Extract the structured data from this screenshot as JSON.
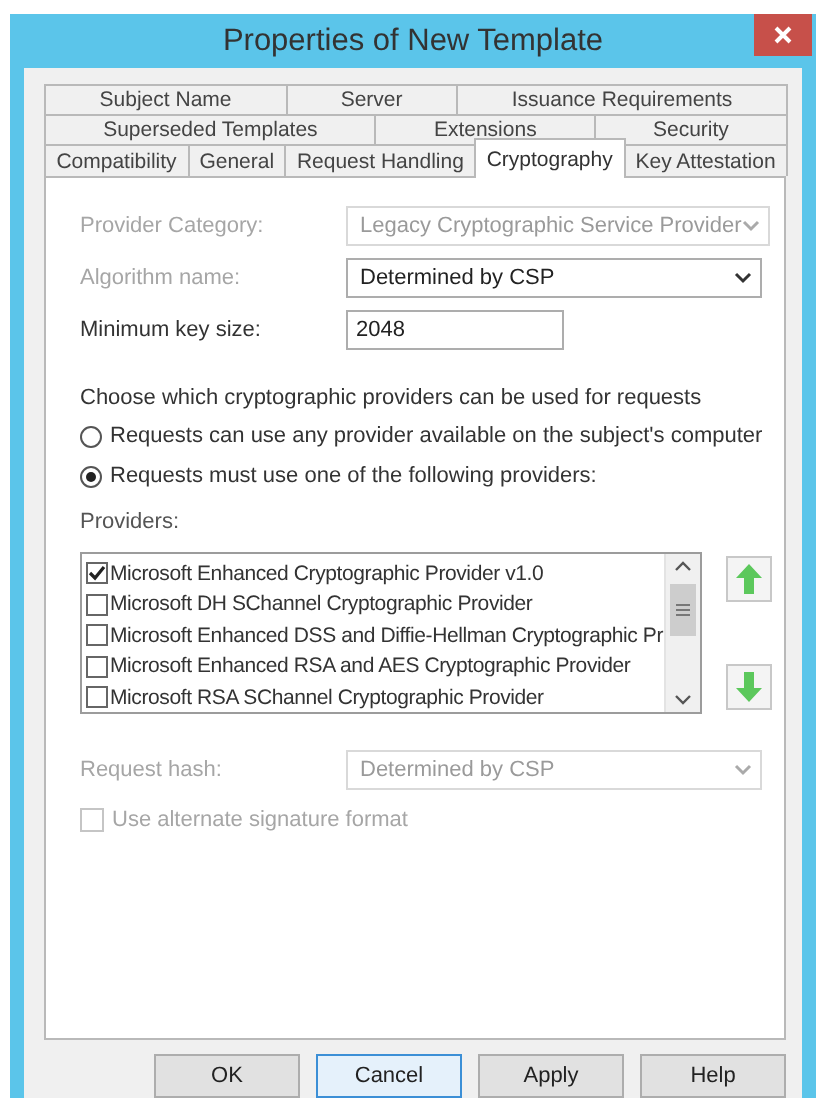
{
  "window": {
    "title": "Properties of New Template"
  },
  "tab_rows": [
    {
      "tabs": [
        {
          "label": "Subject Name",
          "selected": false
        },
        {
          "label": "Server",
          "selected": false
        },
        {
          "label": "Issuance Requirements",
          "selected": false
        }
      ]
    },
    {
      "tabs": [
        {
          "label": "Superseded Templates",
          "selected": false
        },
        {
          "label": "Extensions",
          "selected": false
        },
        {
          "label": "Security",
          "selected": false
        }
      ]
    },
    {
      "tabs": [
        {
          "label": "Compatibility",
          "selected": false
        },
        {
          "label": "General",
          "selected": false
        },
        {
          "label": "Request Handling",
          "selected": false
        },
        {
          "label": "Cryptography",
          "selected": true
        },
        {
          "label": "Key Attestation",
          "selected": false
        }
      ]
    }
  ],
  "fields": [
    {
      "kind": "combo",
      "label": "Provider Category:",
      "label_disabled": true,
      "value": "Legacy Cryptographic Service Provider",
      "disabled": true
    },
    {
      "kind": "combo",
      "label": "Algorithm name:",
      "label_disabled": true,
      "value": "Determined by CSP",
      "disabled": false
    },
    {
      "kind": "text",
      "label": "Minimum key size:",
      "label_disabled": false,
      "value": "2048",
      "disabled": false
    }
  ],
  "provider_choice": {
    "prompt": "Choose which cryptographic providers can be used for requests",
    "options": [
      {
        "label": "Requests can use any provider available on the subject's computer",
        "selected": false
      },
      {
        "label": "Requests must use one of the following providers:",
        "selected": true
      }
    ]
  },
  "providers": {
    "label": "Providers:",
    "items": [
      {
        "name": "Microsoft Enhanced Cryptographic Provider v1.0",
        "checked": true
      },
      {
        "name": "Microsoft DH SChannel Cryptographic Provider",
        "checked": false
      },
      {
        "name": "Microsoft Enhanced DSS and Diffie-Hellman Cryptographic Pr",
        "checked": false
      },
      {
        "name": "Microsoft Enhanced RSA and AES Cryptographic Provider",
        "checked": false
      },
      {
        "name": "Microsoft RSA SChannel Cryptographic Provider",
        "checked": false
      }
    ]
  },
  "request_hash": {
    "kind": "combo",
    "label": "Request hash:",
    "label_disabled": true,
    "value": "Determined by CSP",
    "disabled": true
  },
  "alternate_signature": {
    "label": "Use alternate signature format",
    "checked": false,
    "disabled": true
  },
  "buttons": [
    {
      "label": "OK",
      "focused": false
    },
    {
      "label": "Cancel",
      "focused": true
    },
    {
      "label": "Apply",
      "focused": false
    },
    {
      "label": "Help",
      "focused": false
    }
  ]
}
